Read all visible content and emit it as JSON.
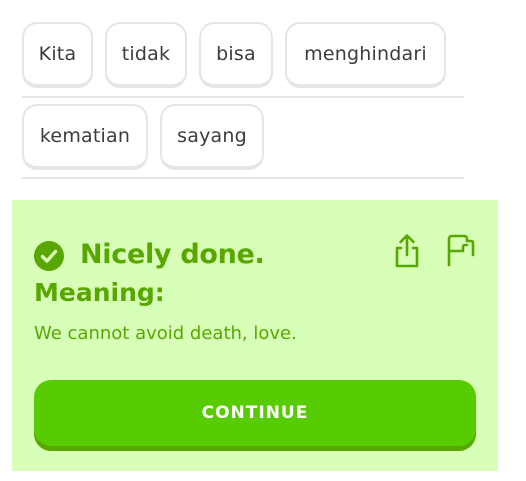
{
  "word_bank": {
    "row1": [
      "Kita",
      "tidak",
      "bisa",
      "menghindari"
    ],
    "row2": [
      "kematian",
      "sayang"
    ]
  },
  "feedback": {
    "title": "Nicely done.",
    "meaning_label": "Meaning:",
    "meaning_text": "We cannot avoid death, love.",
    "continue_label": "CONTINUE",
    "icons": {
      "status": "check-circle-icon",
      "share": "share-icon",
      "report": "flag-icon"
    }
  },
  "colors": {
    "feedback_bg": "#d7ffb8",
    "accent_green": "#58a700",
    "button_green": "#58cc02",
    "tile_border": "#e5e5e5",
    "tile_text": "#3c3c3c"
  }
}
